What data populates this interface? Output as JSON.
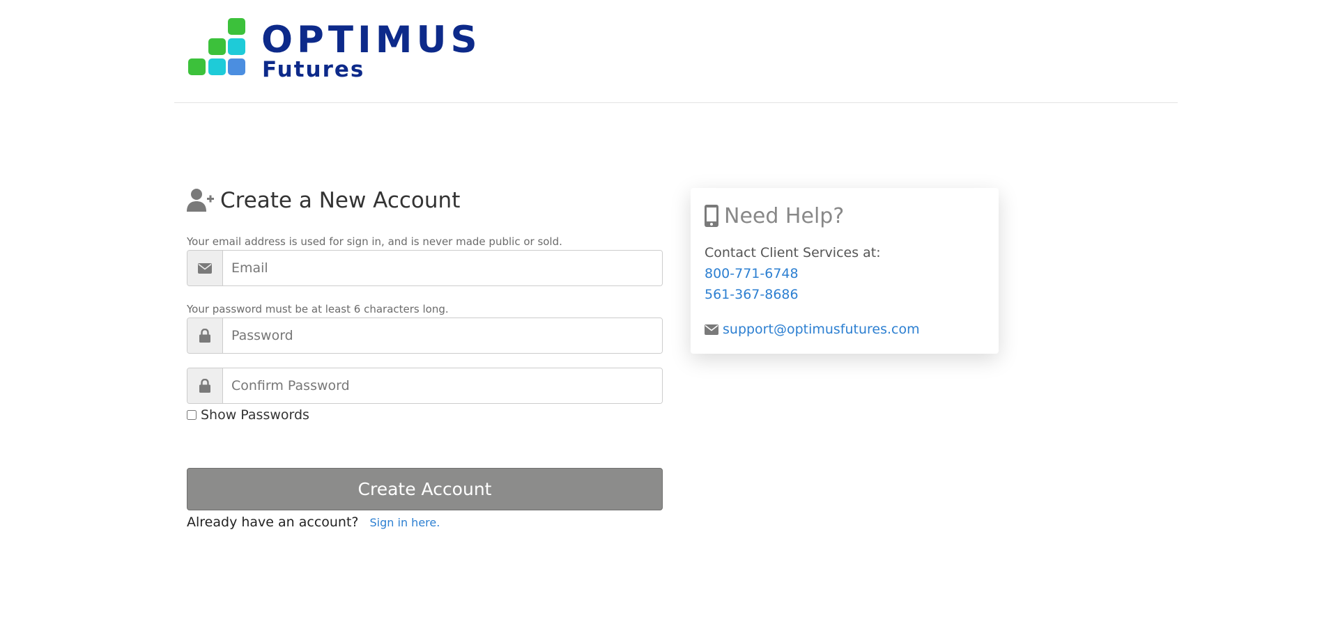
{
  "header": {
    "logo_word_1": "OPTIMUS",
    "logo_word_2": "Futures"
  },
  "form": {
    "title": "Create a New Account",
    "email_help": "Your email address is used for sign in, and is never made public or sold.",
    "email_placeholder": "Email",
    "password_help": "Your password must be at least 6 characters long.",
    "password_placeholder": "Password",
    "confirm_placeholder": "Confirm Password",
    "show_passwords_label": "Show Passwords",
    "create_button_label": "Create Account",
    "already_text": "Already have an account?",
    "sign_in_link": "Sign in here."
  },
  "help": {
    "title": "Need Help?",
    "contact_label": "Contact Client Services at:",
    "phone_1": "800-771-6748",
    "phone_2": "561-367-8686",
    "email": "support@optimusfutures.com"
  },
  "colors": {
    "brand_navy": "#0d2a8a",
    "logo_green": "#3cc13b",
    "logo_cyan": "#1ecbd8",
    "logo_blue": "#4b8ee0",
    "link_blue": "#2c7fd1",
    "button_gray": "#8c8c8b"
  },
  "icons": {
    "title": "user-plus-icon",
    "email_addon": "envelope-icon",
    "password_addon": "lock-icon",
    "confirm_addon": "lock-icon",
    "help_title": "mobile-phone-icon",
    "email_line": "envelope-icon"
  }
}
